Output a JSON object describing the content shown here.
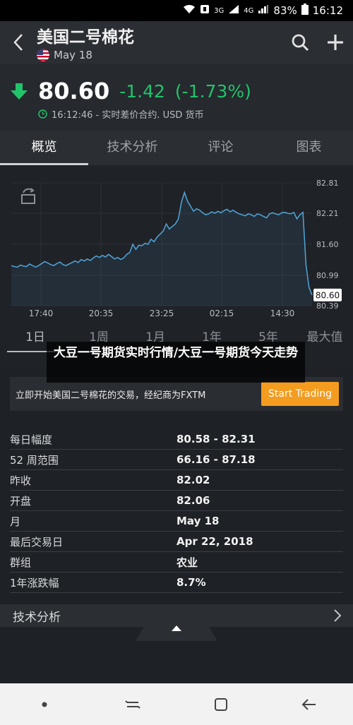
{
  "status_bar": {
    "network_1": "3G",
    "network_2": "4G",
    "battery": "83%",
    "time": "16:12"
  },
  "header": {
    "title": "美国二号棉花",
    "subtitle": "May 18"
  },
  "quote": {
    "price": "80.60",
    "change": "-1.42",
    "change_pct": "(-1.73%)",
    "meta": "16:12:46 - 实时差价合约. USD 货币",
    "color_up": "#21c36b"
  },
  "tabs": [
    "概览",
    "技术分析",
    "评论",
    "图表"
  ],
  "chart_data": {
    "type": "line",
    "x_labels": [
      "17:40",
      "20:35",
      "23:25",
      "02:15",
      "14:30"
    ],
    "y_ticks": [
      "82.81",
      "82.21",
      "81.60",
      "80.99",
      "80.39"
    ],
    "ylim": [
      80.39,
      82.81
    ],
    "last_value_label": "80.60",
    "values": [
      81.18,
      81.16,
      81.15,
      81.19,
      81.17,
      81.16,
      81.21,
      81.18,
      81.15,
      81.18,
      81.22,
      81.26,
      81.23,
      81.2,
      81.18,
      81.22,
      81.25,
      81.2,
      81.18,
      81.21,
      81.24,
      81.27,
      81.24,
      81.3,
      81.27,
      81.31,
      81.28,
      81.33,
      81.37,
      81.34,
      81.38,
      81.35,
      81.4,
      81.36,
      81.31,
      81.34,
      81.3,
      81.33,
      81.4,
      81.44,
      81.6,
      81.5,
      81.58,
      81.57,
      81.62,
      81.6,
      81.7,
      81.65,
      81.74,
      81.8,
      81.86,
      82.0,
      81.9,
      81.95,
      82.0,
      82.1,
      82.43,
      82.62,
      82.45,
      82.35,
      82.25,
      82.3,
      82.27,
      82.22,
      82.18,
      82.2,
      82.24,
      82.21,
      82.25,
      82.22,
      82.26,
      82.29,
      82.24,
      82.27,
      82.23,
      82.2,
      82.18,
      82.16,
      82.2,
      82.18,
      82.15,
      82.2,
      82.18,
      82.15,
      82.12,
      82.2,
      82.22,
      82.2,
      82.18,
      82.22,
      82.23,
      82.21,
      82.2,
      82.23,
      82.1,
      82.18,
      82.23,
      81.2,
      80.75,
      80.6
    ],
    "line_color": "#4f9fd0",
    "grid": true
  },
  "ranges": [
    "1日",
    "1周",
    "1月",
    "1年",
    "5年",
    "最大值"
  ],
  "overlay_text": "大豆一号期货实时行情/大豆一号期货今天走势",
  "promo": {
    "text": "立即开始美国二号棉花的交易，经纪商为FXTM",
    "button": "Start Trading"
  },
  "stats": [
    {
      "label": "每日幅度",
      "value": "80.58 - 82.31"
    },
    {
      "label": "52 周范围",
      "value": "66.16 - 87.18"
    },
    {
      "label": "昨收",
      "value": "82.02"
    },
    {
      "label": "开盘",
      "value": "82.06"
    },
    {
      "label": "月",
      "value": "May 18"
    },
    {
      "label": "最后交易日",
      "value": "Apr 22, 2018"
    },
    {
      "label": "群组",
      "value": "农业"
    },
    {
      "label": "1年涨跌幅",
      "value": "8.7%"
    }
  ],
  "tech_bar": {
    "label": "技术分析"
  }
}
